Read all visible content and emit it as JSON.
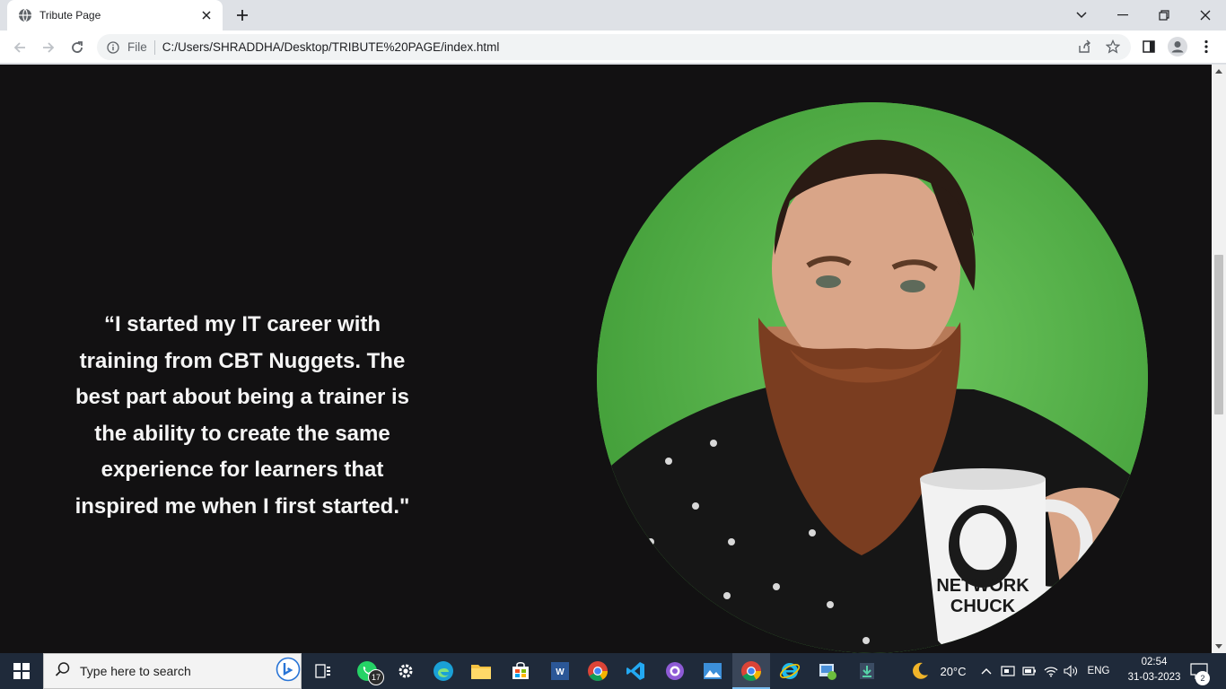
{
  "browser": {
    "tab_title": "Tribute Page",
    "url_scheme": "File",
    "url": "C:/Users/SHRADDHA/Desktop/TRIBUTE%20PAGE/index.html"
  },
  "page": {
    "quote": "“I started my IT career with training from CBT Nuggets. The best part about being a trainer is the ability to create the same experience for learners that inspired me when I first started.\"",
    "image_description": "NETWORK CHUCK",
    "mug_text_line1": "NETWORK",
    "mug_text_line2": "CHUCK"
  },
  "taskbar": {
    "search_placeholder": "Type here to search",
    "whatsapp_badge": "17",
    "weather": "20°C",
    "language": "ENG",
    "time": "02:54",
    "date": "31-03-2023",
    "notification_count": "2"
  },
  "colors": {
    "page_bg": "#121112",
    "portrait_green": "#5ab94f",
    "taskbar_bg": "#1f2a3a"
  }
}
